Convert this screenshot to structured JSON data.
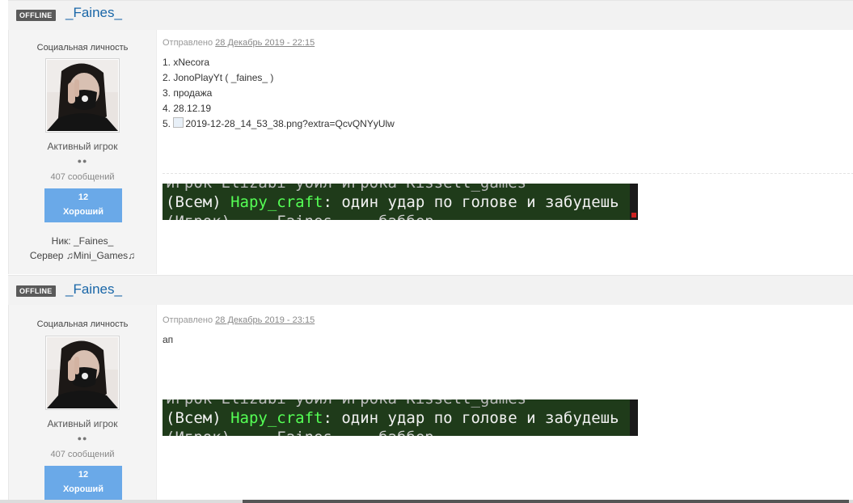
{
  "posts": [
    {
      "status_badge": "OFFLINE",
      "author": "_Faines_",
      "user_title": "Социальная личность",
      "rank": "Активный игрок",
      "rank_dots": "●●",
      "post_count": "407 сообщений",
      "reputation_value": "12",
      "reputation_label": "Хороший",
      "nick_info": "Ник: _Faines_",
      "server_info": "Сервер ♫Mini_Games♫",
      "sent_label": "Отправлено",
      "date": "28 Декабрь 2019 - 22:15",
      "content_lines": [
        "1. xNecora",
        "2. JonoPlayYt ( _faines_ )",
        "3. продажа",
        "4. 28.12.19",
        "5. 2019-12-28_14_53_38.png?extra=QcvQNYyUlw"
      ],
      "signature": {
        "top": "игрок Elizabi убил игрока Kissell_games",
        "prefix": "(Всем) ",
        "name": "Hapy_craft",
        "message": ": один удар по голове и забудешь",
        "bottom": "(Игрок) ... Faines ... баббер"
      }
    },
    {
      "status_badge": "OFFLINE",
      "author": "_Faines_",
      "user_title": "Социальная личность",
      "rank": "Активный игрок",
      "rank_dots": "●●",
      "post_count": "407 сообщений",
      "reputation_value": "12",
      "reputation_label": "Хороший",
      "sent_label": "Отправлено",
      "date": "28 Декабрь 2019 - 23:15",
      "content_lines": [
        "ап"
      ],
      "signature": {
        "top": "игрок Elizabi убил игрока Kissell_games",
        "prefix": "(Всем) ",
        "name": "Hapy_craft",
        "message": ": один удар по голове и забудешь",
        "bottom": "(Игрок) ... Faines ... баббер"
      }
    }
  ],
  "colors": {
    "author_link": "#1a67a8",
    "reputation_bg": "#6aa9e8",
    "badge_bg": "#5a5a5a",
    "signature_bg": "#1f3b1a",
    "signature_name": "#55ff55"
  }
}
